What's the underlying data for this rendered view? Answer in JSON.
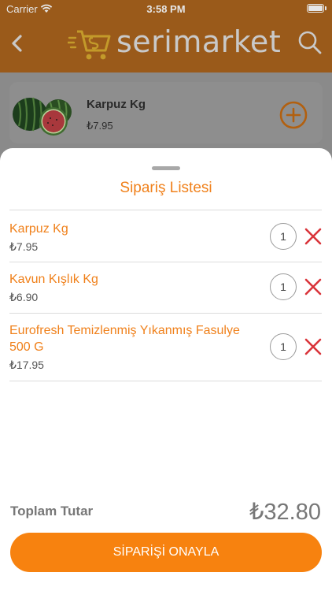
{
  "status_bar": {
    "carrier": "Carrier",
    "time": "3:58 PM"
  },
  "header": {
    "brand": "serimarket",
    "back_icon": "chevron-left-icon",
    "search_icon": "search-icon"
  },
  "background_product": {
    "name": "Karpuz Kg",
    "price": "₺7.95",
    "add_icon": "plus-circle-icon"
  },
  "sheet": {
    "title": "Sipariş Listesi",
    "items": [
      {
        "name": "Karpuz Kg",
        "price": "₺7.95",
        "quantity": "1"
      },
      {
        "name": "Kavun Kışlık Kg",
        "price": "₺6.90",
        "quantity": "1"
      },
      {
        "name": "Eurofresh Temizlenmiş Yıkanmış Fasulye 500 G",
        "price": "₺17.95",
        "quantity": "1"
      }
    ],
    "total_label": "Toplam Tutar",
    "total_value": "₺32.80",
    "confirm_label": "SİPARİŞİ ONAYLA"
  },
  "colors": {
    "accent": "#f7820f",
    "remove": "#d9343a",
    "header_dimmed": "#9a5a1a"
  }
}
